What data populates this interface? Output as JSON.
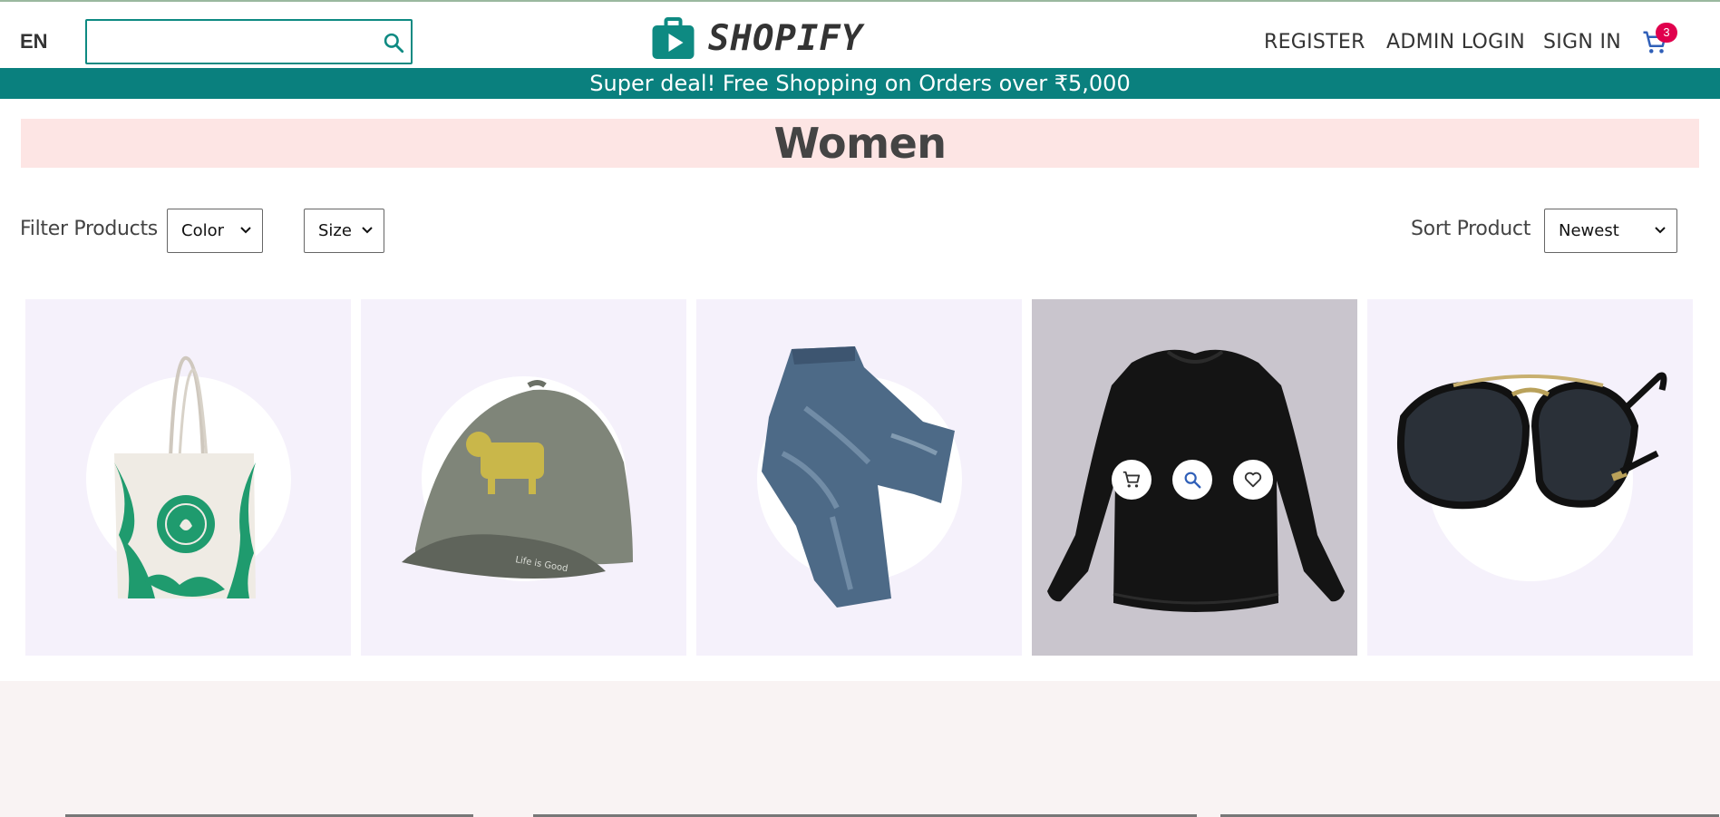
{
  "header": {
    "language": "EN",
    "search_placeholder": "",
    "brand": "SHOPIFY",
    "nav": {
      "register": "REGISTER",
      "admin_login": "ADMIN LOGIN",
      "sign_in": "SIGN IN"
    },
    "cart_count": "3"
  },
  "announcement": "Super deal! Free Shopping on Orders over ₹5,000",
  "page_title": "Women",
  "filters": {
    "filter_label": "Filter Products",
    "color_select": "Color",
    "size_select": "Size",
    "sort_label": "Sort Product",
    "sort_select": "Newest"
  },
  "products": [
    {
      "name": "tote-bag",
      "icon": "tote-bag-image"
    },
    {
      "name": "baseball-cap",
      "icon": "cap-image"
    },
    {
      "name": "jeans",
      "icon": "jeans-image"
    },
    {
      "name": "sweatshirt",
      "icon": "sweatshirt-image",
      "hovered": true
    },
    {
      "name": "sunglasses",
      "icon": "sunglasses-image"
    }
  ],
  "colors": {
    "accent": "#0a807e",
    "title_bg": "#fde5e4",
    "card_bg": "#f5f1fb",
    "badge": "#e0004d"
  }
}
